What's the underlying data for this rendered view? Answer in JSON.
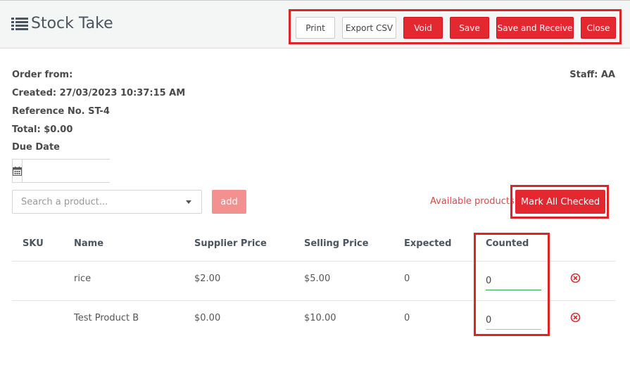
{
  "page": {
    "title": "Stock Take"
  },
  "toolbar": {
    "print": "Print",
    "export_csv": "Export CSV",
    "void": "Void",
    "save": "Save",
    "save_and_receive": "Save and Receive",
    "close": "Close"
  },
  "info": {
    "order_from": "Order from:",
    "created": "Created: 27/03/2023 10:37:15 AM",
    "reference": "Reference No. ST-4",
    "total": "Total: $0.00",
    "due_date": "Due Date",
    "staff": "Staff: AA"
  },
  "due_date": {
    "value": "",
    "icon": "calendar-icon"
  },
  "search": {
    "placeholder": "Search a product..."
  },
  "actions": {
    "add": "add",
    "available_products": "Available products",
    "mark_all_checked": "Mark All Checked"
  },
  "table": {
    "headers": {
      "sku": "SKU",
      "name": "Name",
      "supplier_price": "Supplier Price",
      "selling_price": "Selling Price",
      "expected": "Expected",
      "counted": "Counted"
    },
    "rows": [
      {
        "sku": "",
        "name": "rice",
        "supplier_price": "$2.00",
        "selling_price": "$5.00",
        "expected": "0",
        "counted": "0"
      },
      {
        "sku": "",
        "name": "Test Product B",
        "supplier_price": "$0.00",
        "selling_price": "$10.00",
        "expected": "0",
        "counted": "0"
      }
    ]
  },
  "colors": {
    "accent": "#e3292f",
    "highlight": "#e02424",
    "focus": "#2eaa4a"
  }
}
